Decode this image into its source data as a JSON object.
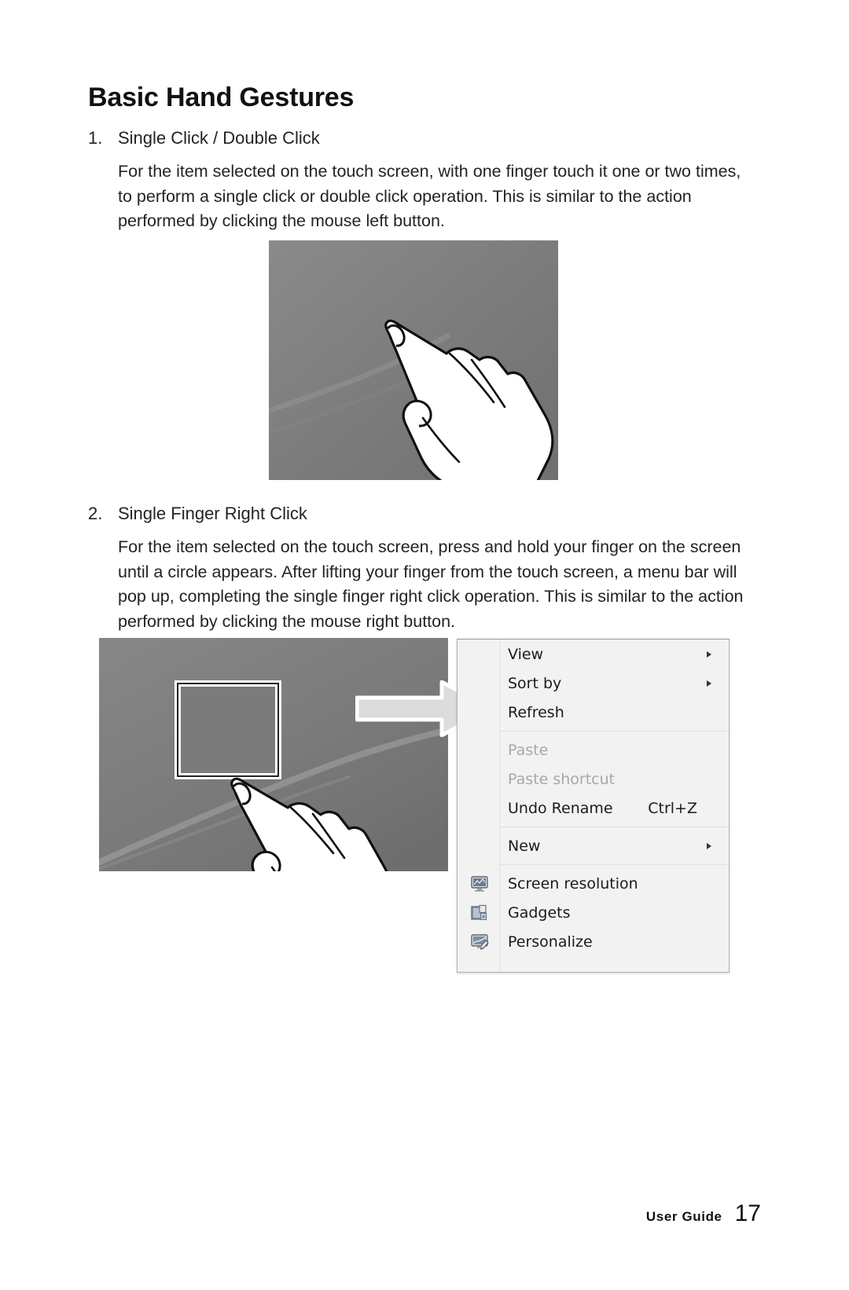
{
  "document": {
    "title": "Basic Hand Gestures"
  },
  "sections": [
    {
      "number": "1.",
      "heading": "Single Click / Double Click",
      "body": "For the item selected on the touch screen, with one finger touch it one or two times, to perform a single click or double click operation. This is similar to the action performed by clicking the mouse left button."
    },
    {
      "number": "2.",
      "heading": "Single Finger Right Click",
      "body": "For the item selected on the touch screen, press and hold your finger on the screen until a circle appears. After lifting your finger from the touch screen, a menu bar will pop up, completing the single finger right click operation. This is similar to the action performed by clicking the mouse right button."
    }
  ],
  "figures": {
    "figure1": {
      "alt": "hand-pointing-one-finger-illustration",
      "background_color": "#7b7b7b"
    },
    "figure2": {
      "alt": "hand-pressing-desktop-icon-illustration",
      "background_color": "#7b7b7b"
    },
    "arrow": {
      "alt": "right-arrow",
      "fill_color": "#dcdcdc",
      "outline_color": "#ffffff"
    }
  },
  "context_menu": {
    "background_color": "#f2f2f2",
    "border_color": "#b4b4b4",
    "groups": [
      {
        "items": [
          {
            "label": "View",
            "icon": "",
            "accel": "",
            "submenu": true,
            "disabled": false
          },
          {
            "label": "Sort by",
            "icon": "",
            "accel": "",
            "submenu": true,
            "disabled": false
          },
          {
            "label": "Refresh",
            "icon": "",
            "accel": "",
            "submenu": false,
            "disabled": false
          }
        ]
      },
      {
        "items": [
          {
            "label": "Paste",
            "icon": "",
            "accel": "",
            "submenu": false,
            "disabled": true
          },
          {
            "label": "Paste shortcut",
            "icon": "",
            "accel": "",
            "submenu": false,
            "disabled": true
          },
          {
            "label": "Undo Rename",
            "icon": "",
            "accel": "Ctrl+Z",
            "submenu": false,
            "disabled": false
          }
        ]
      },
      {
        "items": [
          {
            "label": "New",
            "icon": "",
            "accel": "",
            "submenu": true,
            "disabled": false
          }
        ]
      },
      {
        "items": [
          {
            "label": "Screen resolution",
            "icon": "monitor-icon",
            "accel": "",
            "submenu": false,
            "disabled": false
          },
          {
            "label": "Gadgets",
            "icon": "gadgets-icon",
            "accel": "",
            "submenu": false,
            "disabled": false
          },
          {
            "label": "Personalize",
            "icon": "personalize-icon",
            "accel": "",
            "submenu": false,
            "disabled": false
          }
        ]
      }
    ]
  },
  "footer": {
    "label": "User Guide",
    "page_number": "17"
  }
}
